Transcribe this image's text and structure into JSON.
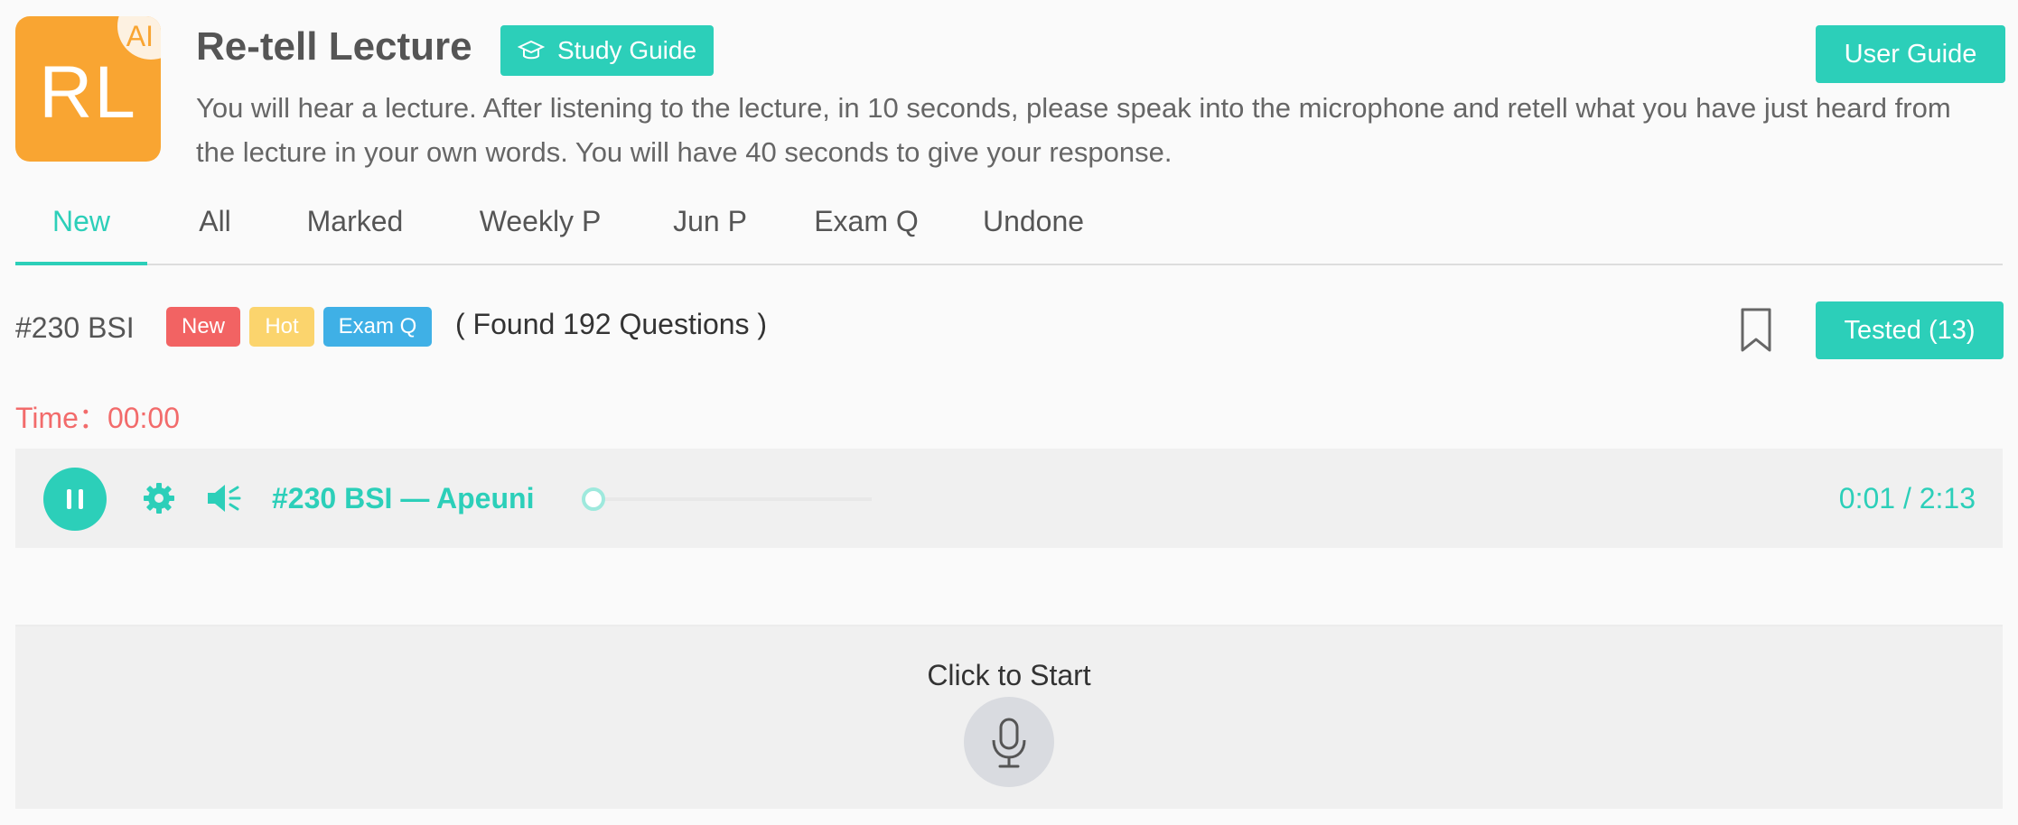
{
  "logo": {
    "letters": "RL",
    "corner_label": "AI",
    "color": "#f9a532"
  },
  "header": {
    "title": "Re-tell Lecture",
    "study_guide_label": "Study Guide",
    "user_guide_label": "User Guide",
    "instructions": "You will hear a lecture. After listening to the lecture, in 10 seconds, please speak into the microphone and retell what you have just heard from the lecture in your own words. You will have 40 seconds to give your response."
  },
  "tabs": [
    {
      "label": "New",
      "active": true
    },
    {
      "label": "All"
    },
    {
      "label": "Marked"
    },
    {
      "label": "Weekly P"
    },
    {
      "label": "Jun P"
    },
    {
      "label": "Exam Q"
    },
    {
      "label": "Undone"
    }
  ],
  "question": {
    "id": "#230 BSI",
    "badges": {
      "new": "New",
      "hot": "Hot",
      "exam": "Exam Q"
    },
    "found_text": "( Found 192 Questions )",
    "tested_label": "Tested (13)",
    "bookmark_icon": "bookmark-icon"
  },
  "timer": {
    "label": "Time：",
    "value": "00:00"
  },
  "player": {
    "track_title": "#230 BSI — Apeuni",
    "time_readout": "0:01 / 2:13",
    "progress_fraction": 0.008,
    "icons": [
      "pause-icon",
      "gear-icon",
      "volume-icon"
    ]
  },
  "record": {
    "prompt": "Click to Start",
    "icon": "microphone-icon"
  },
  "colors": {
    "accent": "#2ccfb9",
    "new_badge": "#f26363",
    "hot_badge": "#fbd46d",
    "exam_badge": "#3fb0e6",
    "timer": "#f26b6b"
  }
}
